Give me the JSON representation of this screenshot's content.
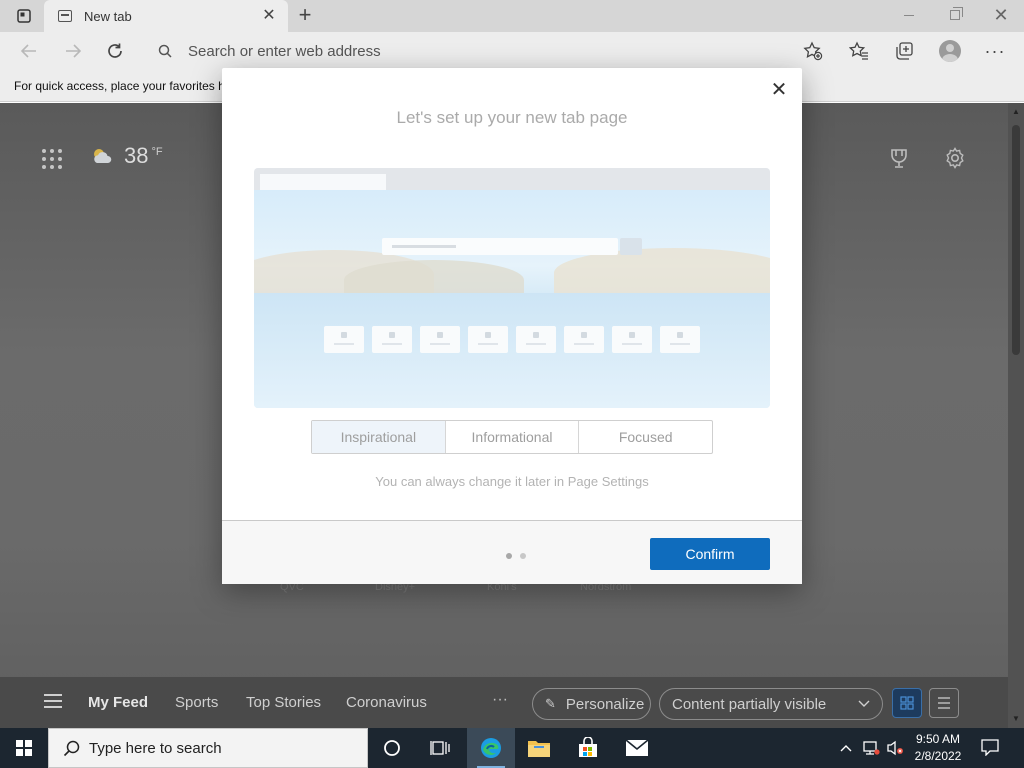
{
  "browser": {
    "tab_title": "New tab",
    "address_placeholder": "Search or enter web address",
    "favorites_hint": "For quick access, place your favorites h"
  },
  "newtab": {
    "temperature": "38",
    "temperature_unit": "°F",
    "quicklinks": [
      "QVC",
      "Disney+",
      "Kohl's",
      "Nordstrom"
    ],
    "feed": {
      "tabs": [
        "My Feed",
        "Sports",
        "Top Stories",
        "Coronavirus"
      ],
      "more": "···",
      "personalize_label": "Personalize",
      "content_visibility": "Content partially visible"
    }
  },
  "modal": {
    "title": "Let's set up your new tab page",
    "options": [
      "Inspirational",
      "Informational",
      "Focused"
    ],
    "selected_option": "Inspirational",
    "note": "You can always change it later in Page Settings",
    "confirm_label": "Confirm",
    "step": 1,
    "total_steps": 2
  },
  "taskbar": {
    "search_placeholder": "Type here to search",
    "time": "9:50 AM",
    "date": "2/8/2022"
  },
  "colors": {
    "accent": "#0f6cbd",
    "taskbar": "#1c2630"
  }
}
